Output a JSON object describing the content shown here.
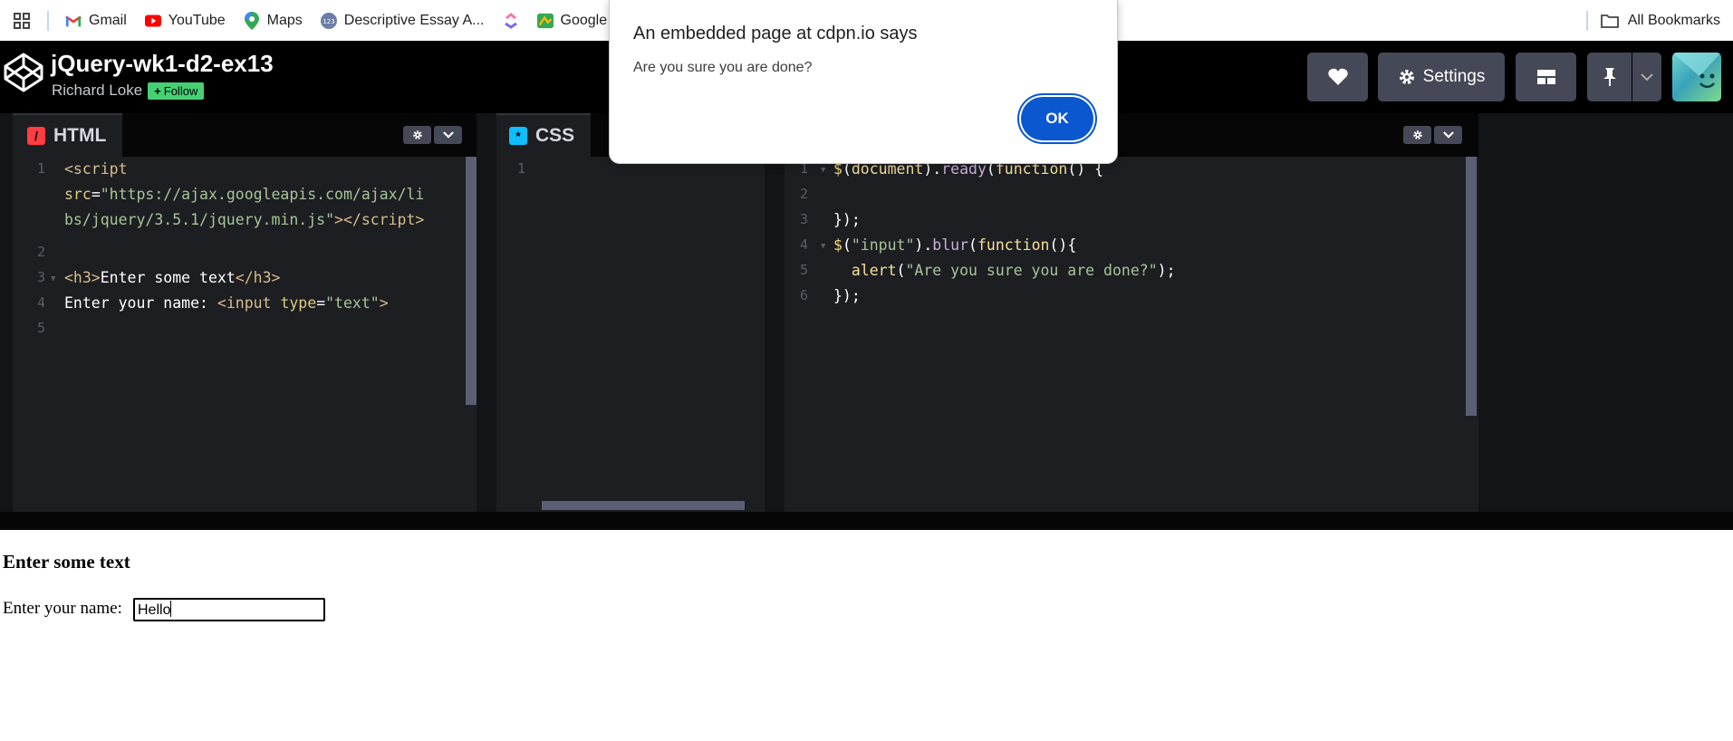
{
  "bookmarks": {
    "items": [
      {
        "label": "Gmail",
        "icon": "gmail-icon"
      },
      {
        "label": "YouTube",
        "icon": "youtube-icon"
      },
      {
        "label": "Maps",
        "icon": "maps-icon"
      },
      {
        "label": "Descriptive Essay A...",
        "icon": "site-icon"
      },
      {
        "label": "",
        "icon": "clickup-icon"
      },
      {
        "label": "Google A",
        "icon": "google-ads-icon"
      }
    ],
    "all_bookmarks": "All Bookmarks"
  },
  "header": {
    "title": "jQuery-wk1-d2-ex13",
    "author": "Richard Loke",
    "follow": "Follow",
    "settings": "Settings"
  },
  "panes": {
    "html": {
      "label": "HTML",
      "color": "#ff3c41"
    },
    "css": {
      "label": "CSS",
      "color": "#0ebeff"
    }
  },
  "code": {
    "html_line_numbers": [
      "1",
      "2",
      "3",
      "4",
      "5"
    ],
    "css_line_numbers": [
      "1"
    ],
    "js_line_numbers": [
      "1",
      "2",
      "3",
      "4",
      "5",
      "6"
    ]
  },
  "preview": {
    "heading": "Enter some text",
    "label": "Enter your name:",
    "input_value": "Hello"
  },
  "alert": {
    "title": "An embedded page at cdpn.io says",
    "message": "Are you sure you are done?",
    "ok": "OK",
    "accent": "#0b57d0"
  }
}
